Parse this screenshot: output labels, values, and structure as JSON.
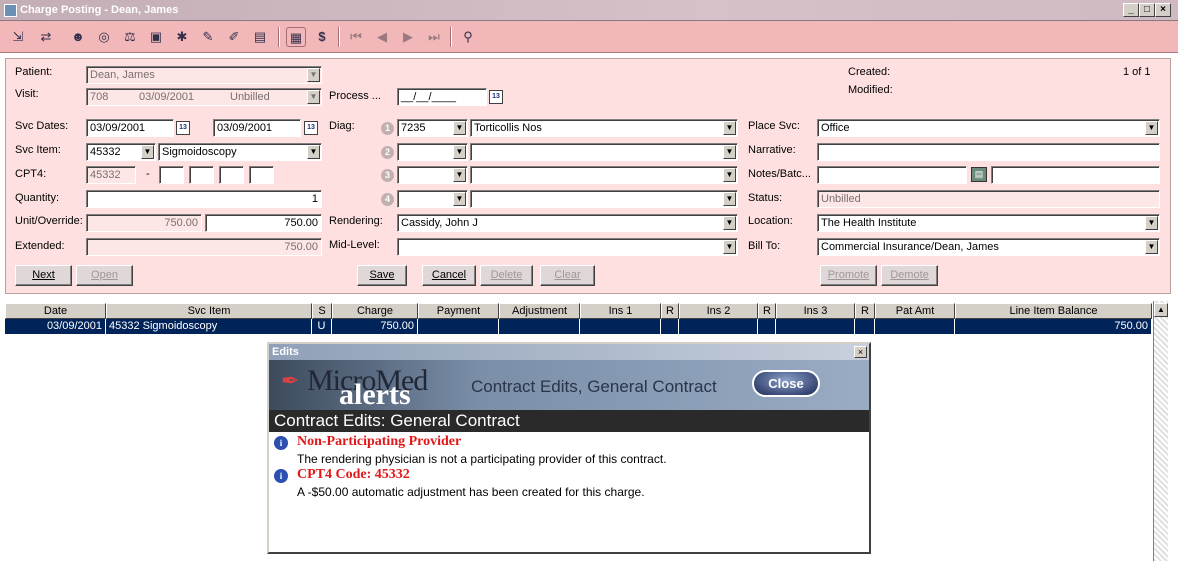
{
  "window": {
    "title": "Charge Posting - Dean, James"
  },
  "toolbar": {
    "icons": [
      "exit-icon",
      "transfer-icon",
      "patient-icon",
      "visit-icon",
      "scales-icon",
      "bank-icon",
      "codes-icon",
      "pen-icon",
      "pencil-icon",
      "monitor-icon",
      "calculator-icon",
      "dollar-icon",
      "first-icon",
      "prev-icon",
      "next-icon",
      "last-icon",
      "find-icon"
    ]
  },
  "form": {
    "patient_label": "Patient:",
    "patient_value": "Dean, James",
    "visit_label": "Visit:",
    "visit_no": "708",
    "visit_date": "03/09/2001",
    "visit_status": "Unbilled",
    "process_label": "Process ...",
    "process_value": "__/__/____",
    "created_label": "Created:",
    "modified_label": "Modified:",
    "page_count": "1 of 1",
    "svc_dates_label": "Svc Dates:",
    "svc_date_from": "03/09/2001",
    "svc_date_to": "03/09/2001",
    "diag_label": "Diag:",
    "diag1_code": "7235",
    "diag1_desc": "Torticollis Nos",
    "place_svc_label": "Place Svc:",
    "place_svc_value": "Office",
    "svc_item_label": "Svc Item:",
    "svc_item_code": "45332",
    "svc_item_desc": "Sigmoidoscopy",
    "narrative_label": "Narrative:",
    "cpt4_label": "CPT4:",
    "cpt4_value": "45332",
    "cpt4_dash": "-",
    "notes_label": "Notes/Batc...",
    "quantity_label": "Quantity:",
    "quantity_value": "1",
    "status_label": "Status:",
    "status_value": "Unbilled",
    "unit_label": "Unit/Override:",
    "unit_value": "750.00",
    "override_value": "750.00",
    "rendering_label": "Rendering:",
    "rendering_value": "Cassidy, John J",
    "location_label": "Location:",
    "location_value": "The Health Institute",
    "extended_label": "Extended:",
    "extended_value": "750.00",
    "midlevel_label": "Mid-Level:",
    "bill_to_label": "Bill To:",
    "bill_to_value": "Commercial Insurance/Dean, James",
    "diag_nums": [
      "1",
      "2",
      "3",
      "4"
    ]
  },
  "buttons": {
    "next": "Next",
    "open": "Open",
    "save": "Save",
    "cancel": "Cancel",
    "delete": "Delete",
    "clear": "Clear",
    "promote": "Promote",
    "demote": "Demote"
  },
  "grid": {
    "columns": [
      "Date",
      "Svc Item",
      "S",
      "Charge",
      "Payment",
      "Adjustment",
      "Ins 1",
      "R",
      "Ins 2",
      "R",
      "Ins 3",
      "R",
      "Pat Amt",
      "Line Item Balance"
    ],
    "rows": [
      {
        "date": "03/09/2001",
        "svc_item": "45332 Sigmoidoscopy",
        "s": "U",
        "charge": "750.00",
        "payment": "",
        "adjustment": "",
        "ins1": "",
        "r1": "",
        "ins2": "",
        "r2": "",
        "ins3": "",
        "r3": "",
        "pat_amt": "",
        "balance": "750.00"
      }
    ]
  },
  "edits_dialog": {
    "title": "Edits",
    "brand_top": "MicroMed",
    "brand_bottom": "alerts",
    "banner_title": "Contract Edits, General Contract",
    "close_label": "Close",
    "heading": "Contract Edits: General Contract",
    "items": [
      {
        "title": "Non-Participating Provider",
        "text": "The rendering physician is not a participating provider of this contract."
      },
      {
        "title": "CPT4 Code: 45332",
        "text": "A -$50.00 automatic adjustment has been created for this charge."
      }
    ]
  },
  "colors": {
    "form_bg": "#ffe0e0",
    "toolbar_bg": "#f1b7b9",
    "row_select": "#00245a",
    "alert_red": "#e01818"
  }
}
